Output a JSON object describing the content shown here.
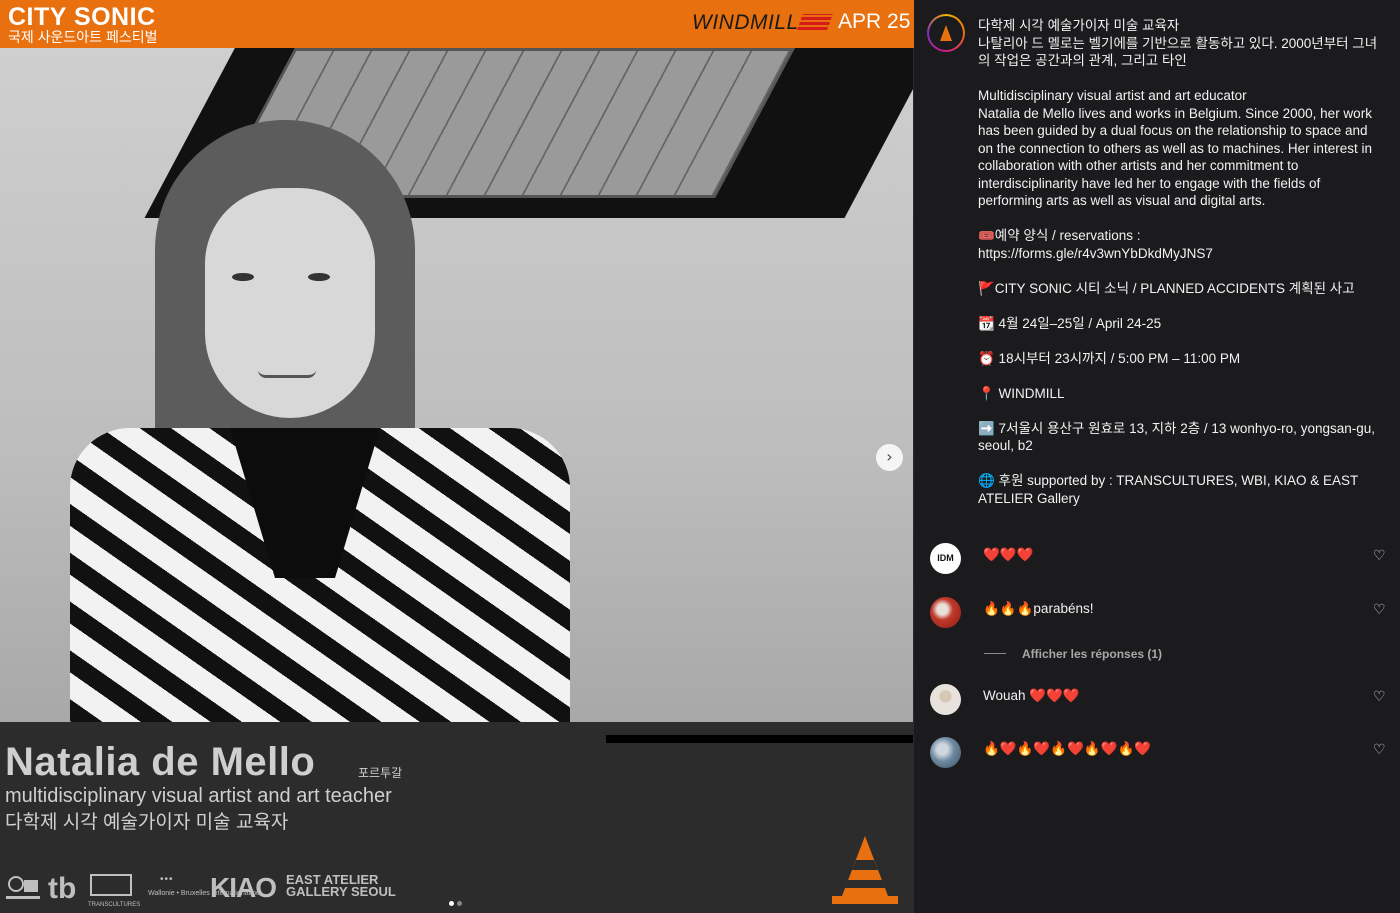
{
  "post": {
    "brand": "CITY SONIC",
    "brand_sub": "국제 사운드아트 페스티벌",
    "venue": "WINDMILL",
    "date": "APR 25",
    "artist_name": "Natalia de Mello",
    "artist_nation": "포르투갈",
    "role_en": "multidisciplinary visual artist and art teacher",
    "role_ko": "다학제 시각 예술가이자 미술 교육자",
    "logos": {
      "tb": "tb",
      "transcultures": "TRANSCULTURES",
      "wbi": "Wallonie • Bruxelles International.be",
      "kiao": "KIAO",
      "east": "EAST ATELIER",
      "east2": "GALLERY SEOUL"
    },
    "carousel": {
      "slides": 2,
      "active": 1
    },
    "next_icon": "chevron-right-icon",
    "accent_color": "#e8700f"
  },
  "caption": {
    "ko_title": "다학제 시각 예술가이자 미술 교육자",
    "ko_body": "나탈리아 드 멜로는 벨기에를 기반으로 활동하고 있다. 2000년부터 그녀의 작업은 공간과의 관계, 그리고 타인",
    "en_title": "Multidisciplinary visual artist and art educator",
    "en_body": "Natalia de Mello lives and works in Belgium. Since 2000, her work has been guided by a dual focus on the relationship to space and on the connection to others as well as to machines. Her interest in collaboration with other artists and her commitment to interdisciplinarity have led her to engage with the fields of performing arts as well as visual and digital arts.",
    "reservation_label": "🎟️예약 양식 / reservations :",
    "reservation_link": "https://forms.gle/r4v3wnYbDkdMyJNS7",
    "event": "🚩CITY SONIC 시티 소닉 / PLANNED ACCIDENTS 계획된 사고",
    "dates": "📆 4월 24일–25일 / April 24-25",
    "time": "⏰ 18시부터 23시까지 / 5:00 PM – 11:00 PM",
    "place": "📍 WINDMILL",
    "address": "➡️ 7서울시 용산구 원효로 13, 지하 2층 / 13 wonhyo-ro, yongsan-gu, seoul, b2",
    "sponsors": "🌐 후원 supported by : TRANSCULTURES, WBI, KIAO & EAST ATELIER Gallery"
  },
  "comments": [
    {
      "text": "❤️❤️❤️",
      "avatar": "IDM"
    },
    {
      "text": "🔥🔥🔥parabéns!",
      "avatar": ""
    },
    {
      "text": "Wouah ❤️❤️❤️",
      "avatar": ""
    },
    {
      "text": "🔥❤️🔥❤️🔥❤️🔥❤️🔥❤️",
      "avatar": ""
    }
  ],
  "replies_label": "Afficher les réponses (1)",
  "heart_icon": "heart-outline-icon"
}
